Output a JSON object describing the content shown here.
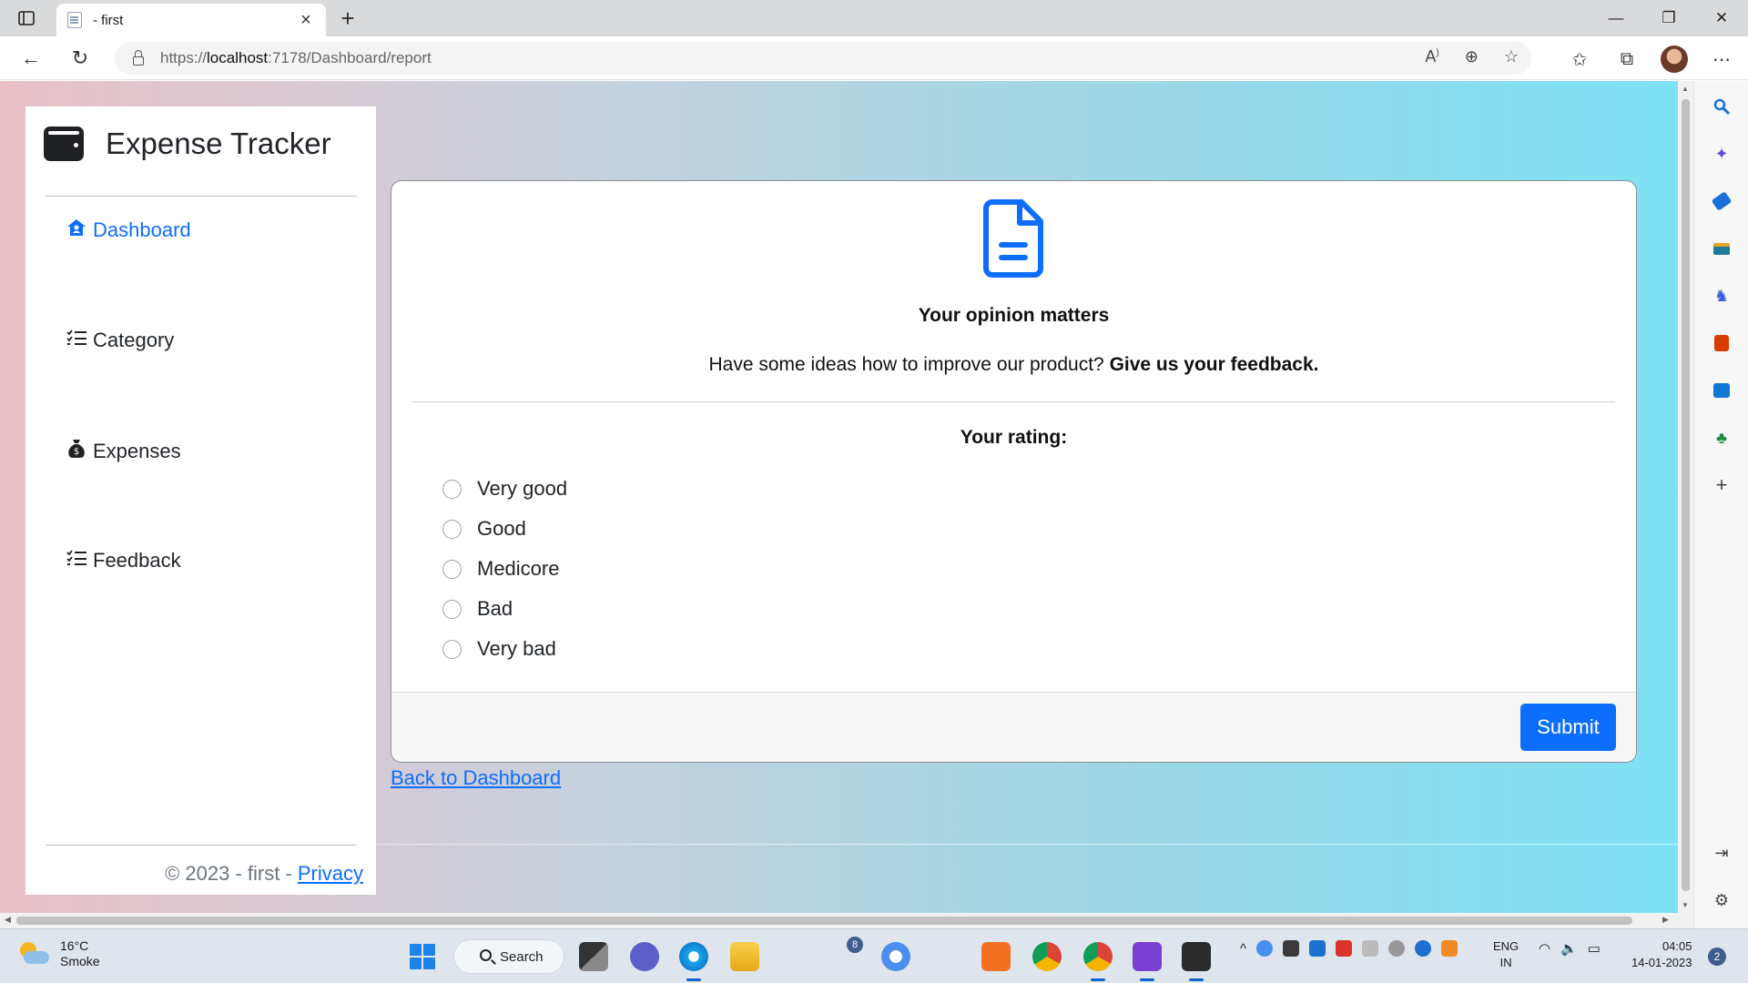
{
  "browser": {
    "tab_title": "- first",
    "url_prefix": "https://",
    "url_host": "localhost",
    "url_path": ":7178/Dashboard/report"
  },
  "sidebar": {
    "brand": "Expense Tracker",
    "items": [
      {
        "label": "Dashboard",
        "icon": "house-user-icon",
        "active": true
      },
      {
        "label": "Category",
        "icon": "list-check-icon",
        "active": false
      },
      {
        "label": "Expenses",
        "icon": "money-bag-icon",
        "active": false
      },
      {
        "label": "Feedback",
        "icon": "list-check-icon",
        "active": false
      }
    ],
    "footer_text": "© 2023 - first - ",
    "footer_link": "Privacy"
  },
  "feedback": {
    "icon": "file-lines-icon",
    "title": "Your opinion matters",
    "subtitle_plain": "Have some ideas how to improve our product? ",
    "subtitle_bold": "Give us your feedback.",
    "rating_label": "Your rating:",
    "options": [
      "Very good",
      "Good",
      "Medicore",
      "Bad",
      "Very bad"
    ],
    "submit_label": "Submit"
  },
  "back_link": "Back to Dashboard",
  "taskbar": {
    "weather_temp": "16°C",
    "weather_desc": "Smoke",
    "search_label": "Search",
    "badge_count": "8",
    "lang_top": "ENG",
    "lang_bottom": "IN",
    "time": "04:05",
    "date": "14-01-2023",
    "notifications": "2"
  },
  "colors": {
    "accent": "#0d6efd",
    "gradient_left": "#eac0c7",
    "gradient_right": "#7de2f4"
  }
}
